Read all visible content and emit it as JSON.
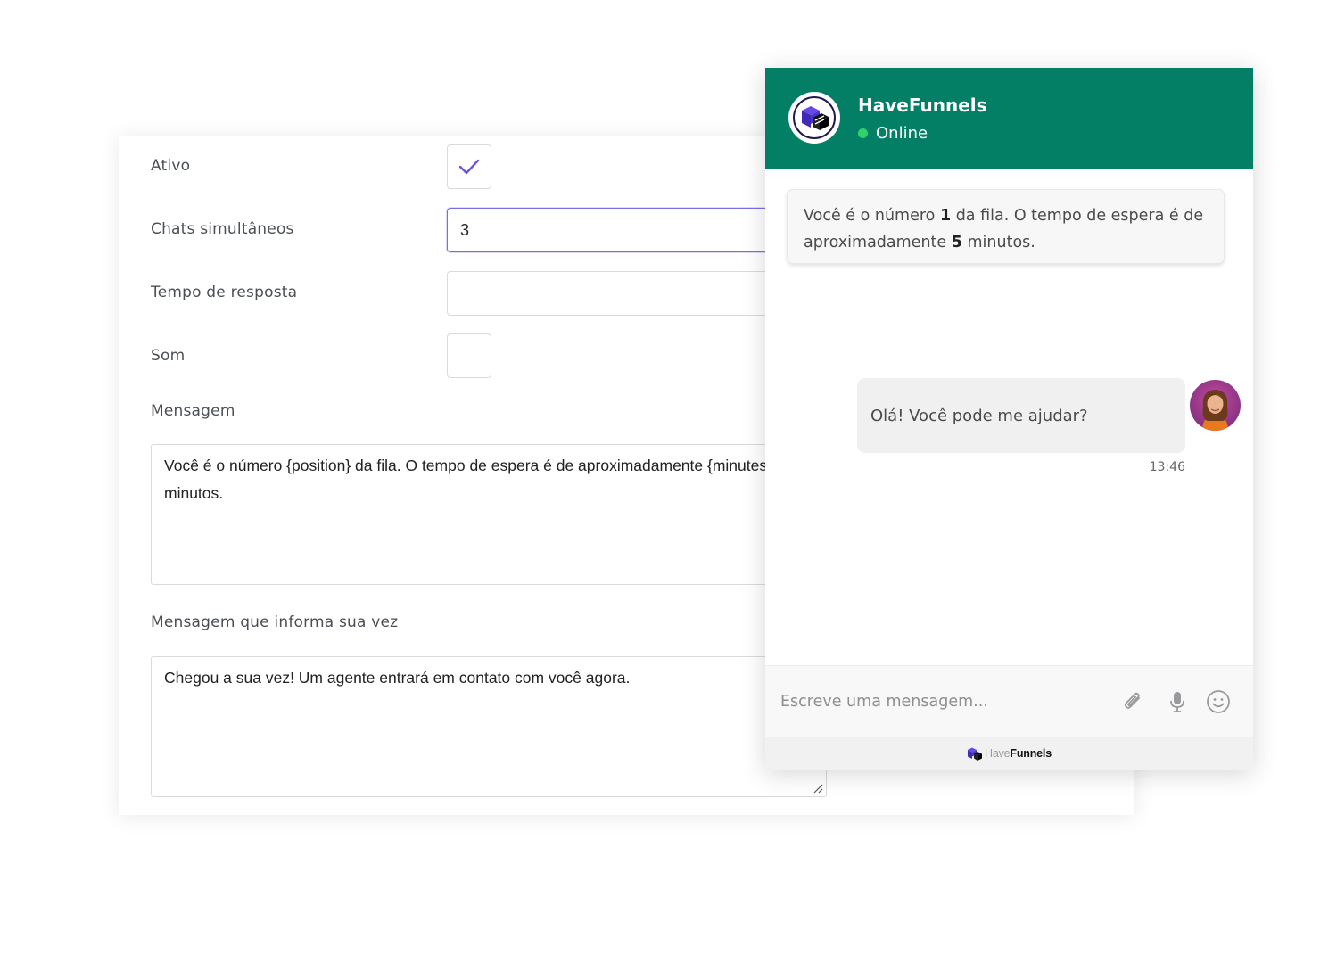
{
  "form": {
    "active_label": "Ativo",
    "active_checked": true,
    "simultaneous_label": "Chats simultâneos",
    "simultaneous_value": "3",
    "response_time_label": "Tempo de resposta",
    "response_time_value": "",
    "sound_label": "Som",
    "sound_checked": false,
    "message_label": "Mensagem",
    "message_value": "Você é o número {position} da fila. O tempo de espera é de aproximadamente {minutes} minutos.",
    "turn_message_label": "Mensagem que informa sua vez",
    "turn_message_value": "Chegou a sua vez! Um agente entrará em contato com você agora.",
    "accent_color": "#7a6ee6"
  },
  "chat": {
    "brand_name": "HaveFunnels",
    "status": "Online",
    "header_color": "#037f65",
    "status_color": "#2fd26b",
    "queue_message": {
      "text_1": "Você é o número ",
      "position": "1",
      "text_2": " da fila. O tempo de espera é de aproximadamente ",
      "minutes": "5",
      "text_3": " minutos."
    },
    "user_message": "Olá! Você pode me ajudar?",
    "user_message_time": "13:46",
    "input_placeholder": "Escreve uma mensagem...",
    "icons": [
      "paperclip-icon",
      "microphone-icon",
      "emoji-icon"
    ],
    "footer": {
      "brand_light": "Have",
      "brand_bold": "Funnels"
    }
  }
}
